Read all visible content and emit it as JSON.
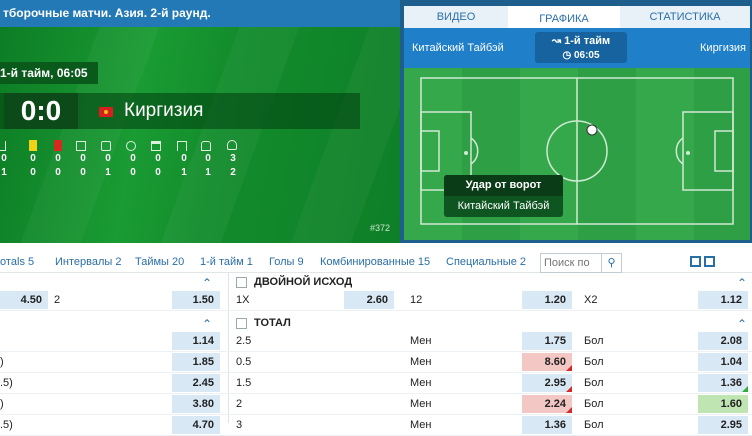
{
  "match_panel": {
    "header": "тборочные матчи. Азия. 2-й раунд.",
    "period": "1-й тайм,",
    "time": "06:05",
    "score": "0:0",
    "team2": "Киргизия",
    "stats_row1": [
      "0",
      "0",
      "0",
      "0",
      "0",
      "0",
      "0",
      "0",
      "0",
      "3"
    ],
    "stats_row2": [
      "1",
      "0",
      "0",
      "0",
      "1",
      "0",
      "0",
      "1",
      "1",
      "2"
    ],
    "match_id": "#372",
    "colors": {
      "pitch": "#118a2a",
      "header": "#2378b6"
    }
  },
  "viz_panel": {
    "tabs": [
      "ВИДЕО",
      "ГРАФИКА",
      "СТАТИСТИКА"
    ],
    "active_tab": "ГРАФИКА",
    "team1": "Китайский Тайбэй",
    "team2": "Киргизия",
    "period": "1-й тайм",
    "time": "06:05",
    "event_title": "Удар от ворот",
    "event_team": "Китайский Тайбэй"
  },
  "market_nav": {
    "items": [
      "отals 5",
      "Интервалы 2",
      "Таймы 20",
      "1-й тайм 1",
      "Голы 9",
      "Комбинированные 15",
      "Специальные 2"
    ],
    "search_placeholder": "Поиск по"
  },
  "left_table": {
    "top_row": {
      "odd1": "4.50",
      "label2": "2",
      "odd2": "1.50"
    },
    "rows": [
      {
        "label": "",
        "odd": "1.14"
      },
      {
        "label": ")",
        "odd": "1.85"
      },
      {
        "label": ".5)",
        "odd": "2.45"
      },
      {
        "label": ")",
        "odd": "3.80"
      },
      {
        "label": ".5)",
        "odd": "4.70"
      }
    ]
  },
  "double_chance": {
    "title": "ДВОЙНОЙ ИСХОД",
    "cells": [
      {
        "label": "1X",
        "odd": "2.60"
      },
      {
        "label": "12",
        "odd": "1.20"
      },
      {
        "label": "X2",
        "odd": "1.12"
      }
    ]
  },
  "totals": {
    "title": "ТОТАЛ",
    "under_label": "Мен",
    "over_label": "Бол",
    "rows": [
      {
        "line": "2.5",
        "under": "1.75",
        "over": "2.08",
        "under_state": "",
        "over_state": ""
      },
      {
        "line": "0.5",
        "under": "8.60",
        "over": "1.04",
        "under_state": "red",
        "over_state": ""
      },
      {
        "line": "1.5",
        "under": "2.95",
        "over": "1.36",
        "under_state": "",
        "over_state": ""
      },
      {
        "line": "2",
        "under": "2.24",
        "over": "1.60",
        "under_state": "red",
        "over_state": "green"
      },
      {
        "line": "3",
        "under": "1.36",
        "over": "2.95",
        "under_state": "",
        "over_state": ""
      }
    ]
  }
}
